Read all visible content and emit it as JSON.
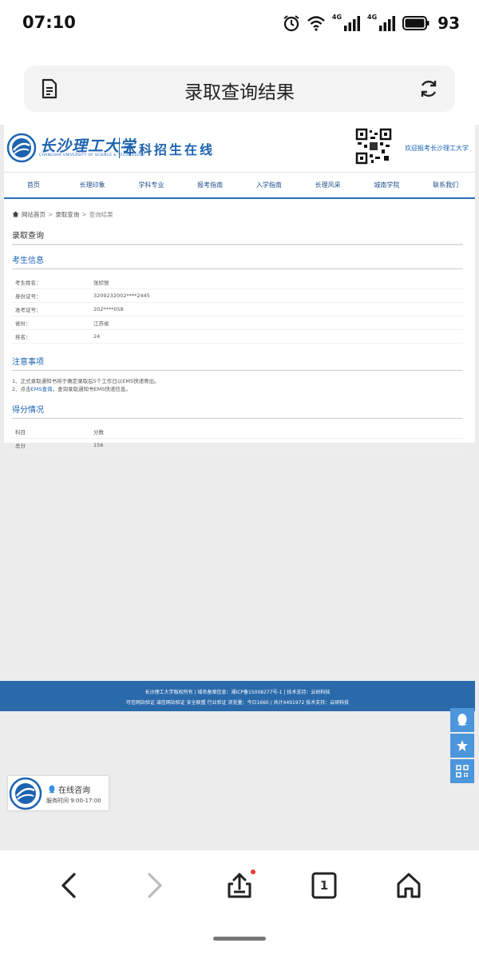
{
  "status": {
    "time": "07:10",
    "net1": "4G",
    "net2": "4G",
    "battery": "93"
  },
  "browser": {
    "title": "录取查询结果"
  },
  "site": {
    "logo_cn": "长沙理工大学",
    "logo_en": "CHANGSHA UNIVERSITY OF SCIENCE & TECHNOLOGY",
    "logo_sub": "本科招生在线",
    "welcome": "欢迎报考长沙理工大学",
    "nav": [
      "首页",
      "长理印象",
      "学科专业",
      "报考指南",
      "入学指南",
      "长理风采",
      "城南学院",
      "联系我们"
    ]
  },
  "breadcrumb": {
    "home": "网站首页",
    "sep1": ">",
    "mid": "录取查询",
    "sep2": ">",
    "current": "查询结果"
  },
  "page_title": "录取查询",
  "student_section": {
    "title": "考生信息",
    "rows": [
      {
        "label": "考生姓名：",
        "value": "张欣悦"
      },
      {
        "label": "身份证号：",
        "value": "3209232002****2445"
      },
      {
        "label": "准考证号：",
        "value": "202****058"
      },
      {
        "label": "省份：",
        "value": "江苏省"
      },
      {
        "label": "排名：",
        "value": "24"
      }
    ]
  },
  "notice_section": {
    "title": "注意事项",
    "line1": "1、正式录取通知书将于确定录取后5个工作日以EMS快递寄出。",
    "line2_pre": "2、点击",
    "line2_link": "EMS查询",
    "line2_post": "，查询录取通知书EMS快递信息。"
  },
  "score_section": {
    "title": "得分情况",
    "rows": [
      {
        "label": "科目",
        "value": "分数"
      },
      {
        "label": "总分",
        "value": "156"
      }
    ]
  },
  "footer": {
    "line1": "长沙理工大学版权所有 | 域名备案信息：湘ICP备15008277号-1 | 技术支持：云研科技",
    "line2": "可信网站验证   诚信网站验证   安全联盟   行业验证   浏览量：今日1660 / 共计4491972   技术支持：云研科技"
  },
  "consult": {
    "title": "在线咨询",
    "hours": "服务时间 9:00-17:00"
  },
  "bottom": {
    "tabs_count": "1"
  }
}
